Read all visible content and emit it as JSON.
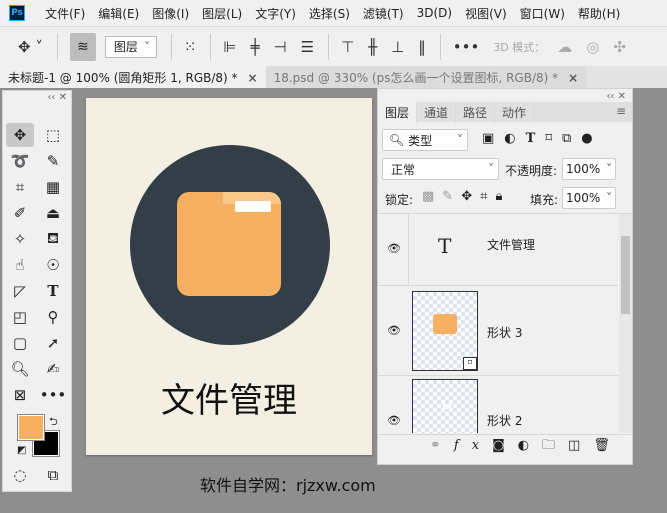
{
  "app": {
    "logo": "Ps"
  },
  "menu": [
    "文件(F)",
    "编辑(E)",
    "图像(I)",
    "图层(L)",
    "文字(Y)",
    "选择(S)",
    "滤镜(T)",
    "3D(D)",
    "视图(V)",
    "窗口(W)",
    "帮助(H)"
  ],
  "options_bar": {
    "auto_select_value": "图层",
    "mode_label": "3D 模式："
  },
  "doc_tabs": [
    {
      "label": "未标题-1 @ 100% (圆角矩形 1, RGB/8) *",
      "active": true
    },
    {
      "label": "18.psd @ 330% (ps怎么画一个设置图标, RGB/8) *",
      "active": false
    }
  ],
  "colors": {
    "foreground": "#f5b062",
    "background": "#000000",
    "canvas_bg": "#f3efe2",
    "circle": "#333e48",
    "folder": "#f5b062"
  },
  "canvas": {
    "title_text": "文件管理"
  },
  "layers_panel": {
    "tabs": [
      "图层",
      "通道",
      "路径",
      "动作"
    ],
    "filter_value": "类型",
    "blend_mode": "正常",
    "opacity_label": "不透明度:",
    "opacity_value": "100%",
    "lock_label": "锁定:",
    "fill_label": "填充:",
    "fill_value": "100%",
    "layers": [
      {
        "name": "文件管理",
        "type": "text",
        "visible": true
      },
      {
        "name": "形状 3",
        "type": "shape",
        "visible": true
      },
      {
        "name": "形状 2",
        "type": "shape",
        "visible": true
      }
    ]
  },
  "watermark": "软件自学网：rjzxw.com"
}
